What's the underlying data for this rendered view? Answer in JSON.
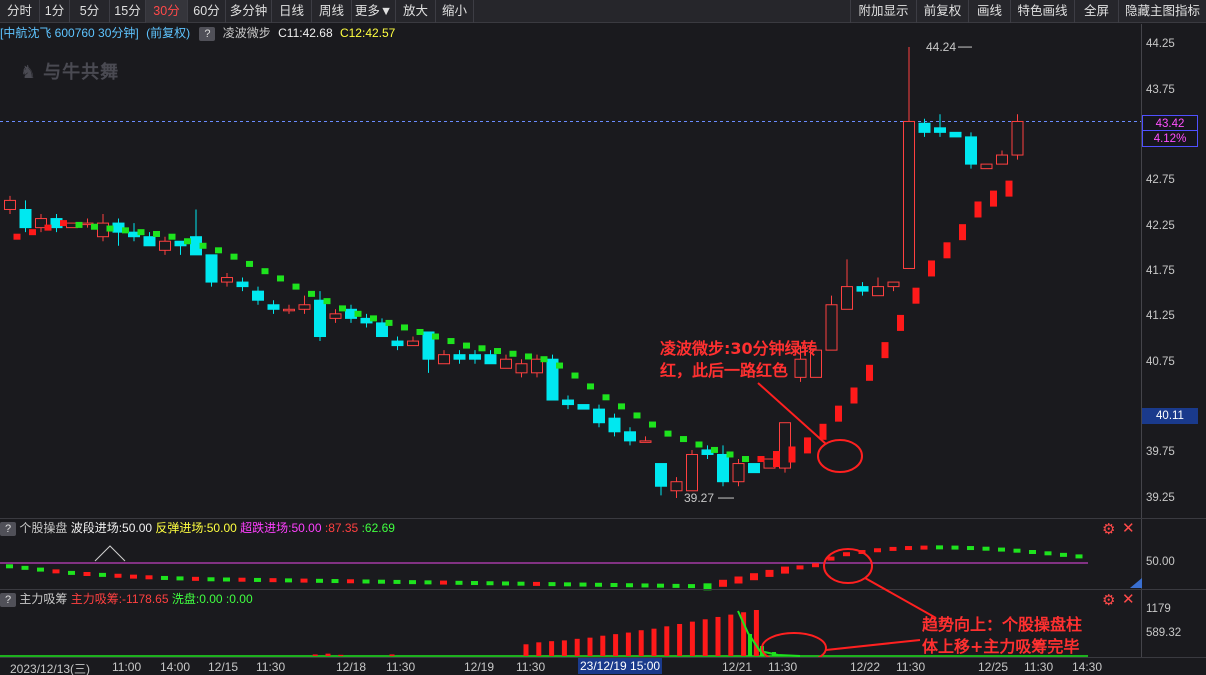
{
  "toolbar": {
    "left": [
      "分时",
      "1分",
      "5分",
      "15分",
      "30分",
      "60分",
      "多分钟",
      "日线",
      "周线",
      "更多▼",
      "放大",
      "缩小"
    ],
    "active": "30分",
    "right": [
      "附加显示",
      "前复权",
      "画线",
      "特色画线",
      "全屏",
      "隐藏主图指标"
    ]
  },
  "info": {
    "stock": "[中航沈飞 600760 30分钟]",
    "adjust": "(前复权)",
    "qmark": "?",
    "indicator": "凌波微步",
    "c1": "C11:42.68",
    "c2": "C12:42.57"
  },
  "logo_text": "与牛共舞",
  "main_chart": {
    "y_ticks": [
      "44.25",
      "43.75",
      "43.25",
      "42.75",
      "42.25",
      "41.75",
      "41.25",
      "40.75",
      "39.75",
      "39.25"
    ],
    "ymin": 39.05,
    "ymax": 44.45,
    "high_label": "44.24",
    "low_label": "39.27",
    "current_price": "43.42",
    "current_pct": "4.12%",
    "cursor_price": "40.11",
    "candles": [
      [
        42.45,
        42.55,
        42.4,
        42.6
      ],
      [
        42.45,
        42.25,
        42.2,
        42.55
      ],
      [
        42.25,
        42.35,
        42.2,
        42.4
      ],
      [
        42.35,
        42.25,
        42.2,
        42.4
      ],
      [
        42.25,
        42.3,
        42.25,
        42.3
      ],
      [
        42.3,
        42.3,
        42.25,
        42.35
      ],
      [
        42.15,
        42.3,
        42.1,
        42.4
      ],
      [
        42.3,
        42.2,
        42.05,
        42.35
      ],
      [
        42.2,
        42.15,
        42.1,
        42.3
      ],
      [
        42.15,
        42.05,
        42.05,
        42.2
      ],
      [
        42.0,
        42.1,
        41.95,
        42.15
      ],
      [
        42.1,
        42.05,
        41.95,
        42.1
      ],
      [
        42.15,
        41.95,
        41.95,
        42.45
      ],
      [
        41.95,
        41.65,
        41.6,
        41.95
      ],
      [
        41.65,
        41.7,
        41.6,
        41.75
      ],
      [
        41.65,
        41.6,
        41.55,
        41.7
      ],
      [
        41.55,
        41.45,
        41.4,
        41.6
      ],
      [
        41.4,
        41.35,
        41.3,
        41.45
      ],
      [
        41.35,
        41.35,
        41.3,
        41.4
      ],
      [
        41.35,
        41.4,
        41.3,
        41.5
      ],
      [
        41.45,
        41.05,
        41.0,
        41.55
      ],
      [
        41.25,
        41.3,
        41.2,
        41.35
      ],
      [
        41.35,
        41.25,
        41.2,
        41.4
      ],
      [
        41.25,
        41.2,
        41.15,
        41.3
      ],
      [
        41.2,
        41.05,
        41.05,
        41.25
      ],
      [
        41.0,
        40.95,
        40.9,
        41.05
      ],
      [
        40.95,
        41.0,
        40.95,
        41.05
      ],
      [
        41.1,
        40.8,
        40.65,
        41.1
      ],
      [
        40.75,
        40.85,
        40.75,
        40.9
      ],
      [
        40.85,
        40.8,
        40.75,
        40.9
      ],
      [
        40.85,
        40.8,
        40.75,
        40.9
      ],
      [
        40.85,
        40.75,
        40.75,
        40.9
      ],
      [
        40.7,
        40.8,
        40.7,
        40.85
      ],
      [
        40.65,
        40.75,
        40.6,
        40.8
      ],
      [
        40.65,
        40.8,
        40.6,
        40.85
      ],
      [
        40.8,
        40.35,
        40.35,
        40.85
      ],
      [
        40.35,
        40.3,
        40.25,
        40.4
      ],
      [
        40.3,
        40.25,
        40.25,
        40.3
      ],
      [
        40.25,
        40.1,
        40.05,
        40.3
      ],
      [
        40.15,
        40.0,
        39.95,
        40.2
      ],
      [
        40.0,
        39.9,
        39.85,
        40.05
      ],
      [
        39.9,
        39.9,
        39.9,
        39.95
      ],
      [
        39.65,
        39.4,
        39.3,
        39.65
      ],
      [
        39.35,
        39.45,
        39.27,
        39.5
      ],
      [
        39.35,
        39.75,
        39.35,
        39.8
      ],
      [
        39.8,
        39.75,
        39.7,
        39.85
      ],
      [
        39.75,
        39.45,
        39.4,
        39.85
      ],
      [
        39.45,
        39.65,
        39.4,
        39.7
      ],
      [
        39.65,
        39.55,
        39.55,
        39.65
      ],
      [
        39.6,
        39.7,
        39.6,
        39.7
      ],
      [
        39.6,
        40.1,
        39.55,
        40.1
      ],
      [
        40.6,
        40.8,
        40.55,
        40.95
      ],
      [
        40.6,
        40.9,
        40.6,
        40.95
      ],
      [
        40.9,
        41.4,
        40.9,
        41.5
      ],
      [
        41.35,
        41.6,
        41.35,
        41.9
      ],
      [
        41.6,
        41.55,
        41.5,
        41.65
      ],
      [
        41.5,
        41.6,
        41.5,
        41.7
      ],
      [
        41.6,
        41.65,
        41.55,
        41.65
      ],
      [
        41.8,
        43.42,
        41.8,
        44.24
      ],
      [
        43.4,
        43.3,
        43.25,
        43.45
      ],
      [
        43.35,
        43.3,
        43.25,
        43.5
      ],
      [
        43.3,
        43.25,
        43.25,
        43.3
      ],
      [
        43.25,
        42.95,
        42.9,
        43.3
      ],
      [
        42.9,
        42.95,
        42.9,
        42.95
      ],
      [
        42.95,
        43.05,
        42.95,
        43.1
      ],
      [
        43.05,
        43.42,
        43.0,
        43.5
      ]
    ],
    "lbwb_dots": [
      [
        42.15,
        "r"
      ],
      [
        42.2,
        "r"
      ],
      [
        42.25,
        "r"
      ],
      [
        42.3,
        "r"
      ],
      [
        42.28,
        "g"
      ],
      [
        42.26,
        "g"
      ],
      [
        42.24,
        "g"
      ],
      [
        42.22,
        "g"
      ],
      [
        42.2,
        "g"
      ],
      [
        42.18,
        "g"
      ],
      [
        42.15,
        "g"
      ],
      [
        42.1,
        "g"
      ],
      [
        42.05,
        "g"
      ],
      [
        42.0,
        "g"
      ],
      [
        41.93,
        "g"
      ],
      [
        41.85,
        "g"
      ],
      [
        41.77,
        "g"
      ],
      [
        41.69,
        "g"
      ],
      [
        41.6,
        "g"
      ],
      [
        41.52,
        "g"
      ],
      [
        41.44,
        "g"
      ],
      [
        41.36,
        "g"
      ],
      [
        41.3,
        "g"
      ],
      [
        41.25,
        "g"
      ],
      [
        41.2,
        "g"
      ],
      [
        41.15,
        "g"
      ],
      [
        41.1,
        "g"
      ],
      [
        41.05,
        "g"
      ],
      [
        41.0,
        "g"
      ],
      [
        40.95,
        "g"
      ],
      [
        40.92,
        "g"
      ],
      [
        40.89,
        "g"
      ],
      [
        40.86,
        "g"
      ],
      [
        40.83,
        "g"
      ],
      [
        40.8,
        "g"
      ],
      [
        40.73,
        "g"
      ],
      [
        40.62,
        "g"
      ],
      [
        40.5,
        "g"
      ],
      [
        40.38,
        "g"
      ],
      [
        40.28,
        "g"
      ],
      [
        40.18,
        "g"
      ],
      [
        40.08,
        "g"
      ],
      [
        39.98,
        "g"
      ],
      [
        39.92,
        "g"
      ],
      [
        39.86,
        "g"
      ],
      [
        39.8,
        "g"
      ],
      [
        39.75,
        "g"
      ],
      [
        39.7,
        "g"
      ],
      [
        39.7,
        "r"
      ],
      [
        39.7,
        "r"
      ],
      [
        39.75,
        "r"
      ],
      [
        39.85,
        "r"
      ],
      [
        40.0,
        "r"
      ],
      [
        40.2,
        "r"
      ],
      [
        40.4,
        "r"
      ],
      [
        40.65,
        "r"
      ],
      [
        40.9,
        "r"
      ],
      [
        41.2,
        "r"
      ],
      [
        41.5,
        "r"
      ],
      [
        41.8,
        "r"
      ],
      [
        42.0,
        "r"
      ],
      [
        42.2,
        "r"
      ],
      [
        42.45,
        "r"
      ],
      [
        42.57,
        "r"
      ],
      [
        42.68,
        "r"
      ]
    ]
  },
  "annotation1": {
    "line1": "凌波微步:30分钟绿转",
    "line2": "红，此后一路红色"
  },
  "annotation2": {
    "line1": "趋势向上：个股操盘柱",
    "line2": "体上移+主力吸筹完毕"
  },
  "ind1": {
    "qmark": "?",
    "name": "个股操盘",
    "wave": "波段进场:50.00",
    "rebound": "反弹进场:50.00",
    "oversold": "超跌进场:50.00",
    "v1": ":87.35",
    "v2": ":62.69",
    "axis_label": "50.00",
    "values": [
      [
        48.5,
        "g"
      ],
      [
        47.8,
        "g"
      ],
      [
        47,
        "g"
      ],
      [
        46.2,
        "r"
      ],
      [
        45.5,
        "g"
      ],
      [
        45,
        "r"
      ],
      [
        44.6,
        "g"
      ],
      [
        44.2,
        "r"
      ],
      [
        43.8,
        "r"
      ],
      [
        43.5,
        "r"
      ],
      [
        43.2,
        "g"
      ],
      [
        43,
        "g"
      ],
      [
        42.8,
        "r"
      ],
      [
        42.6,
        "g"
      ],
      [
        42.5,
        "g"
      ],
      [
        42.4,
        "r"
      ],
      [
        42.3,
        "g"
      ],
      [
        42.2,
        "r"
      ],
      [
        42.1,
        "g"
      ],
      [
        42,
        "r"
      ],
      [
        41.9,
        "g"
      ],
      [
        41.8,
        "g"
      ],
      [
        41.7,
        "r"
      ],
      [
        41.6,
        "g"
      ],
      [
        41.5,
        "g"
      ],
      [
        41.4,
        "g"
      ],
      [
        41.3,
        "g"
      ],
      [
        41.2,
        "g"
      ],
      [
        41.1,
        "r"
      ],
      [
        41,
        "g"
      ],
      [
        40.9,
        "g"
      ],
      [
        40.8,
        "g"
      ],
      [
        40.7,
        "g"
      ],
      [
        40.6,
        "g"
      ],
      [
        40.5,
        "r"
      ],
      [
        40.4,
        "g"
      ],
      [
        40.3,
        "g"
      ],
      [
        40.2,
        "g"
      ],
      [
        40.1,
        "g"
      ],
      [
        40,
        "g"
      ],
      [
        39.9,
        "g"
      ],
      [
        39.8,
        "g"
      ],
      [
        39.7,
        "g"
      ],
      [
        39.6,
        "g"
      ],
      [
        39.5,
        "g"
      ],
      [
        39.4,
        "g"
      ],
      [
        41,
        "r"
      ],
      [
        42.5,
        "r"
      ],
      [
        44,
        "r"
      ],
      [
        45.5,
        "r"
      ],
      [
        47,
        "r"
      ],
      [
        48,
        "r"
      ],
      [
        49,
        "r"
      ],
      [
        52,
        "r"
      ],
      [
        54,
        "r"
      ],
      [
        55,
        "r"
      ],
      [
        55.8,
        "r"
      ],
      [
        56.4,
        "r"
      ],
      [
        56.8,
        "r"
      ],
      [
        57,
        "r"
      ],
      [
        57.1,
        "g"
      ],
      [
        57,
        "g"
      ],
      [
        56.8,
        "g"
      ],
      [
        56.5,
        "g"
      ],
      [
        56.1,
        "g"
      ],
      [
        55.6,
        "g"
      ],
      [
        55,
        "g"
      ],
      [
        54.4,
        "g"
      ],
      [
        53.7,
        "g"
      ],
      [
        53,
        "g"
      ]
    ]
  },
  "ind2": {
    "qmark": "?",
    "name": "主力吸筹",
    "main": "主力吸筹:-1178.65",
    "wash": "洗盘:0.00",
    "v": ":0.00",
    "axis1": "1179",
    "axis2": "589.32",
    "bars": [
      0,
      0,
      0,
      0,
      0,
      0,
      0,
      0,
      0,
      0,
      0,
      0,
      0,
      0,
      0,
      0,
      0,
      0,
      0,
      0,
      0,
      0,
      0,
      0,
      40,
      60,
      30,
      0,
      0,
      0,
      40,
      0,
      0,
      0,
      0,
      300,
      350,
      380,
      400,
      440,
      470,
      520,
      560,
      600,
      660,
      700,
      760,
      820,
      880,
      940,
      1000,
      1060,
      1120,
      1178,
      0,
      0,
      0,
      0,
      0,
      0,
      0,
      0,
      0,
      0,
      0,
      0,
      0
    ],
    "green_bars": [
      52,
      53,
      54,
      55
    ]
  },
  "xaxis": [
    "2023/12/13(三)",
    "11:00",
    "14:00",
    "12/15",
    "11:30",
    "12/18",
    "11:30",
    "12/19",
    "11:30",
    "23/12/19 15:00",
    "12/21",
    "11:30",
    "12/22",
    "11:30",
    "12/25",
    "11:30",
    "14:30"
  ],
  "colors": {
    "up": "#ff4040",
    "down": "#00e8f0",
    "green": "#1ee31e",
    "red": "#ff1a1a",
    "purple": "#c040c0",
    "accent": "#ff4a4a"
  }
}
